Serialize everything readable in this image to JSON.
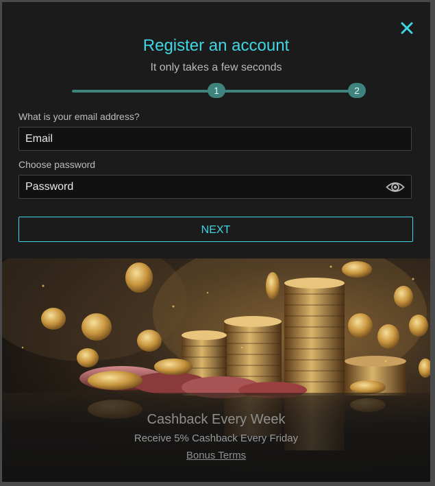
{
  "modal": {
    "title": "Register an account",
    "subtitle": "It only takes a few seconds",
    "close_icon": "close-icon",
    "accent_color": "#40d6e3",
    "progress": {
      "steps": [
        "1",
        "2"
      ],
      "current_step": 2
    }
  },
  "form": {
    "email": {
      "label": "What is your email address?",
      "placeholder": "Email",
      "value": ""
    },
    "password": {
      "label": "Choose password",
      "placeholder": "Password",
      "value": "",
      "toggle_icon": "eye-icon"
    },
    "next_label": "NEXT"
  },
  "promo": {
    "image": "casino-chips-coins-image",
    "title": "Cashback Every Week",
    "subtitle": "Receive 5% Cashback Every Friday",
    "link_label": "Bonus Terms"
  }
}
